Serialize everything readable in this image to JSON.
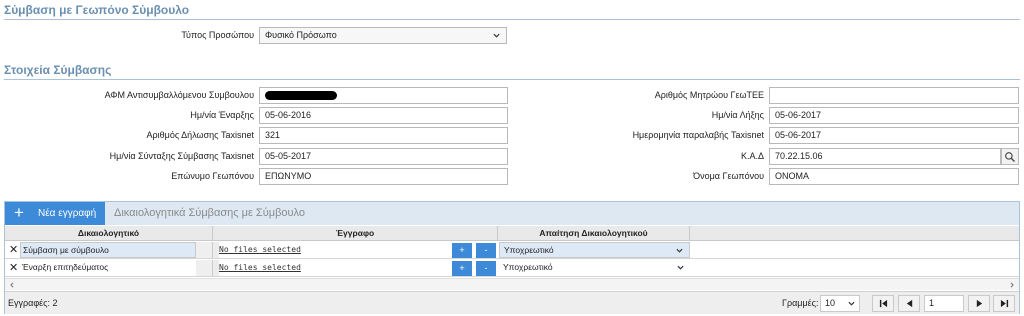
{
  "section1": {
    "title": "Σύμβαση με Γεωπόνο Σύμβουλο"
  },
  "person_type": {
    "label": "Τύπος Προσώπου",
    "value": "Φυσικό Πρόσωπο"
  },
  "section2": {
    "title": "Στοιχεία Σύμβασης"
  },
  "form": {
    "afm_label": "ΑΦΜ Αντισυμβαλλόμενου Συμβουλου",
    "afm_value": "",
    "start_label": "Ημ/νία Έναρξης",
    "start_value": "05-06-2016",
    "decl_label": "Αριθμός Δήλωσης Taxisnet",
    "decl_value": "321",
    "sign_label": "Ημ/νία Σύνταξης Σύμβασης Taxisnet",
    "sign_value": "05-05-2017",
    "surname_label": "Επώνυμο Γεωπόνου",
    "surname_value": "ΕΠΩΝΥΜΟ",
    "reg_label": "Αριθμός Μητρώου ΓεωΤΕΕ",
    "reg_value": "",
    "end_label": "Ημ/νία Λήξης",
    "end_value": "05-06-2017",
    "receipt_label": "Ημερομηνία παραλαβής Taxisnet",
    "receipt_value": "05-06-2017",
    "kad_label": "Κ.Α.Δ",
    "kad_value": "70.22.15.06",
    "name_label": "Όνομα Γεωπόνου",
    "name_value": "ΟΝΟΜΑ"
  },
  "grid": {
    "new_button": "Νέα εγγραφή",
    "title": "Δικαιολογητικά Σύμβασης με Σύμβουλο",
    "columns": [
      "Δικαιολογητικό",
      "Έγγραφο",
      "Απαίτηση Δικαιολογητικού"
    ],
    "rows": [
      {
        "doc": "Σύμβαση με σύμβουλο",
        "file": "No files selected",
        "plus": "+",
        "minus": "-",
        "req": "Υποχρεωτικό"
      },
      {
        "doc": "Έναρξη επιτηδεύματος",
        "file": "No files selected",
        "plus": "+",
        "minus": "-",
        "req": "Υποχρεωτικό"
      }
    ]
  },
  "footer": {
    "records": "Εγγραφές: 2",
    "rows_label": "Γραμμές:",
    "rows_value": "10",
    "page_value": "1"
  }
}
